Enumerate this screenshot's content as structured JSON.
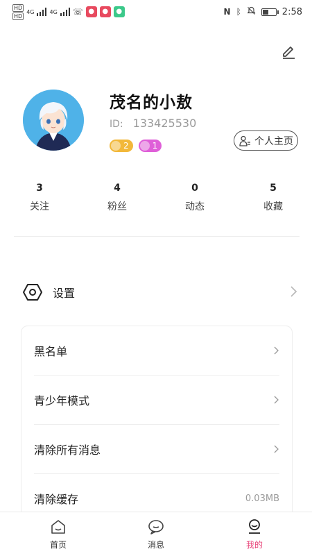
{
  "status_bar": {
    "tags": [
      "HD",
      "HD"
    ],
    "net1": "4G",
    "net2": "4G",
    "time": "2:58",
    "battery_level": 0.45
  },
  "profile": {
    "username": "茂名的小敖",
    "id_label": "ID:",
    "id_value": "133425530",
    "badge_gold_value": "2",
    "badge_pink_value": "1",
    "homepage_label": "个人主页"
  },
  "stats": [
    {
      "value": "3",
      "label": "关注"
    },
    {
      "value": "4",
      "label": "粉丝"
    },
    {
      "value": "0",
      "label": "动态"
    },
    {
      "value": "5",
      "label": "收藏"
    }
  ],
  "settings": {
    "label": "设置"
  },
  "menu": [
    {
      "label": "黑名单",
      "value": ""
    },
    {
      "label": "青少年模式",
      "value": ""
    },
    {
      "label": "清除所有消息",
      "value": ""
    },
    {
      "label": "清除缓存",
      "value": "0.03MB"
    }
  ],
  "nav": [
    {
      "label": "首页",
      "icon": "home-icon"
    },
    {
      "label": "消息",
      "icon": "chat-icon"
    },
    {
      "label": "我的",
      "icon": "profile-icon"
    }
  ],
  "colors": {
    "accent": "#e8457a",
    "badge_gold": "#f2b83a",
    "badge_pink": "#df5fd8",
    "avatar_bg": "#4fb2e8"
  }
}
